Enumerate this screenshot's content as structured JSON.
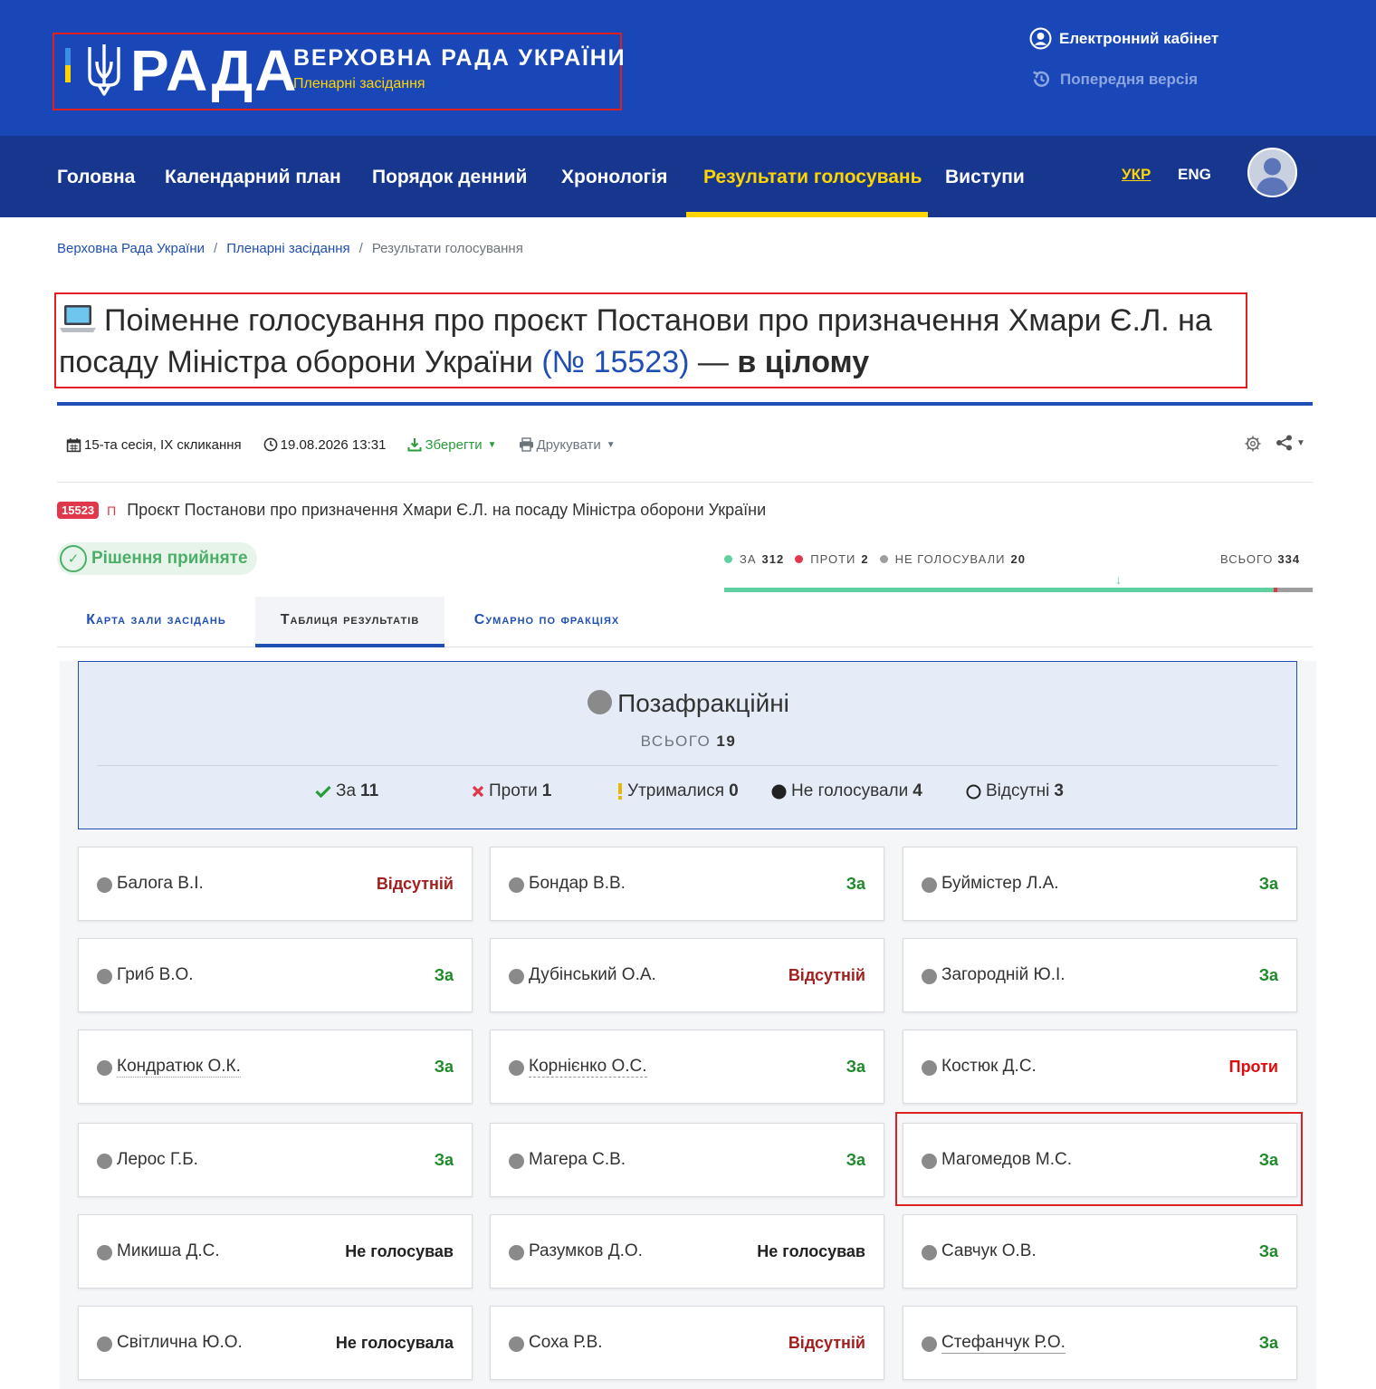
{
  "header": {
    "logo_word": "РАДА",
    "org_name": "ВЕРХОВНА РАДА УКРАЇНИ",
    "org_sub": "Пленарні засідання",
    "cabinet_label": "Електронний кабінет",
    "prev_version_label": "Попередня версія"
  },
  "nav": {
    "items": [
      "Головна",
      "Календарний план",
      "Порядок денний",
      "Хронологія",
      "Результати голосувань",
      "Виступи"
    ],
    "active_index": 4,
    "lang_ukr": "УКР",
    "lang_eng": "ENG"
  },
  "breadcrumb": {
    "items": [
      "Верховна Рада України",
      "Пленарні засідання",
      "Результати голосування"
    ],
    "separator": "/"
  },
  "title": {
    "main": "Поіменне голосування про проєкт Постанови про призначення Хмари Є.Л. на посаду Міністра оборони України",
    "number": "(№ 15523)",
    "dash": "—",
    "scope": "в цілому"
  },
  "toolbar": {
    "session": "15-та сесія, IX скликання",
    "datetime": "19.08.2026 13:31",
    "save_label": "Зберегти",
    "print_label": "Друкувати"
  },
  "bill": {
    "number": "15523",
    "type": "П",
    "text": "Проєкт Постанови про призначення Хмари Є.Л. на посаду Міністра оборони України"
  },
  "decision": "Рішення прийняте",
  "tally": {
    "for_label": "ЗА",
    "for_value": "312",
    "against_label": "ПРОТИ",
    "against_value": "2",
    "novote_label": "НЕ ГОЛОСУВАЛИ",
    "novote_value": "20",
    "total_label": "ВСЬОГО",
    "total_value": "334",
    "for_share": 0.934,
    "against_share": 0.006
  },
  "tabs": [
    "Карта зали засідань",
    "Таблиця результатів",
    "Сумарно по фракціях"
  ],
  "faction": {
    "name": "Позафракційні",
    "total_label": "ВСЬОГО",
    "total_value": "19",
    "stats": [
      {
        "label": "За",
        "value": "11"
      },
      {
        "label": "Проти",
        "value": "1"
      },
      {
        "label": "Утрималися",
        "value": "0"
      },
      {
        "label": "Не голосували",
        "value": "4"
      },
      {
        "label": "Відсутні",
        "value": "3"
      }
    ]
  },
  "deputies": [
    {
      "name": "Балога В.І.",
      "vote": "Відсутній"
    },
    {
      "name": "Бондар В.В.",
      "vote": "За"
    },
    {
      "name": "Буймістер Л.А.",
      "vote": "За"
    },
    {
      "name": "Гриб В.О.",
      "vote": "За"
    },
    {
      "name": "Дубінський О.А.",
      "vote": "Відсутній"
    },
    {
      "name": "Загородній Ю.І.",
      "vote": "За"
    },
    {
      "name": "Кондратюк О.К.",
      "vote": "За"
    },
    {
      "name": "Корнієнко О.С.",
      "vote": "За"
    },
    {
      "name": "Костюк Д.С.",
      "vote": "Проти"
    },
    {
      "name": "Лерос Г.Б.",
      "vote": "За"
    },
    {
      "name": "Магера С.В.",
      "vote": "За"
    },
    {
      "name": "Магомедов М.С.",
      "vote": "За"
    },
    {
      "name": "Микиша Д.С.",
      "vote": "Не голосував"
    },
    {
      "name": "Разумков Д.О.",
      "vote": "Не голосував"
    },
    {
      "name": "Савчук О.В.",
      "vote": "За"
    },
    {
      "name": "Світлична Ю.О.",
      "vote": "Не голосувала"
    },
    {
      "name": "Соха Р.В.",
      "vote": "Відсутній"
    },
    {
      "name": "Стефанчук Р.О.",
      "vote": "За"
    }
  ],
  "colors": {
    "header_blue": "#1a47b8",
    "nav_blue": "#17378f",
    "accent_yellow": "#ffd500",
    "link_blue": "#1f4fb5",
    "for_green": "#1e8a29",
    "against_red": "#e00b0b",
    "absent_red": "#a3201f"
  }
}
